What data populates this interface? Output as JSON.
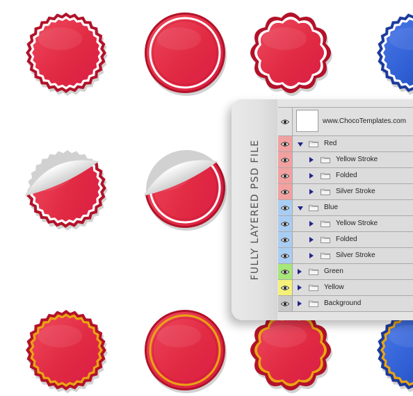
{
  "colors": {
    "red": "#e12a43",
    "red_dark": "#b3122a",
    "blue": "#2f5fd4",
    "blue_dark": "#1c3b9c",
    "gold": "#e9a512",
    "silver": "#ffffff",
    "label_red": "#f2a0a0",
    "label_blue": "#a9cdf2",
    "label_green": "#a7e77a",
    "label_yellow": "#f4f07a",
    "label_gray": "#c9c9c9"
  },
  "panel": {
    "banner": "FULLY LAYERED PSD FILE",
    "document_layer": "www.ChocoTemplates.com",
    "layers": [
      {
        "label": "Red",
        "color": "label_red",
        "level": 0,
        "state": "open"
      },
      {
        "label": "Yellow Stroke",
        "color": "label_red",
        "level": 1,
        "state": "closed"
      },
      {
        "label": "Folded",
        "color": "label_red",
        "level": 1,
        "state": "closed"
      },
      {
        "label": "Silver Stroke",
        "color": "label_red",
        "level": 1,
        "state": "closed"
      },
      {
        "label": "Blue",
        "color": "label_blue",
        "level": 0,
        "state": "open"
      },
      {
        "label": "Yellow Stroke",
        "color": "label_blue",
        "level": 1,
        "state": "closed"
      },
      {
        "label": "Folded",
        "color": "label_blue",
        "level": 1,
        "state": "closed"
      },
      {
        "label": "Silver Stroke",
        "color": "label_blue",
        "level": 1,
        "state": "closed"
      },
      {
        "label": "Green",
        "color": "label_green",
        "level": 0,
        "state": "closed"
      },
      {
        "label": "Yellow",
        "color": "label_yellow",
        "level": 0,
        "state": "closed"
      },
      {
        "label": "Background",
        "color": "label_gray",
        "level": 0,
        "state": "closed"
      }
    ]
  },
  "stickers": [
    {
      "name": "red-zigzag-sticker-silver",
      "shape": "zigzag",
      "fill": "red",
      "trim": "silver"
    },
    {
      "name": "red-round-sticker-silver",
      "shape": "round",
      "fill": "red",
      "trim": "silver"
    },
    {
      "name": "red-scalloped-sticker-silver",
      "shape": "scallop",
      "fill": "red",
      "trim": "silver"
    },
    {
      "name": "blue-zigzag-sticker-silver",
      "shape": "zigzag",
      "fill": "blue",
      "trim": "silver"
    },
    {
      "name": "red-zigzag-sticker-folded",
      "shape": "zigzag-folded",
      "fill": "red",
      "trim": "silver"
    },
    {
      "name": "red-round-sticker-folded",
      "shape": "round-folded",
      "fill": "red",
      "trim": "silver"
    },
    {
      "name": "red-zigzag-sticker-gold",
      "shape": "zigzag",
      "fill": "red",
      "trim": "gold"
    },
    {
      "name": "red-round-sticker-gold",
      "shape": "round",
      "fill": "red",
      "trim": "gold"
    },
    {
      "name": "red-scalloped-sticker-gold",
      "shape": "scallop",
      "fill": "red",
      "trim": "gold"
    },
    {
      "name": "blue-zigzag-sticker-gold",
      "shape": "zigzag",
      "fill": "blue",
      "trim": "gold"
    }
  ]
}
